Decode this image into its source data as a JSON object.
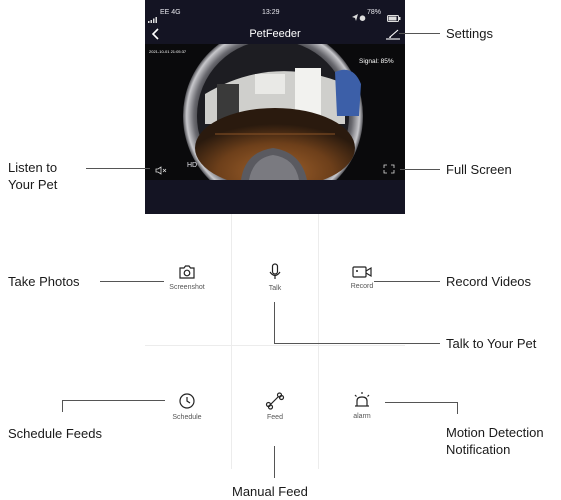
{
  "status_bar": {
    "carrier": "EE  4G",
    "time": "13:29",
    "battery": "78%"
  },
  "header": {
    "title": "PetFeeder"
  },
  "feed": {
    "timestamp": "2021-10-01 21:05:37",
    "signal": "Signal: 85%",
    "quality": "HD"
  },
  "controls": {
    "screenshot": "Screenshot",
    "talk": "Talk",
    "record": "Record",
    "schedule": "Schedule",
    "feed": "Feed",
    "alarm": "alarm"
  },
  "callouts": {
    "settings": "Settings",
    "listen_line1": "Listen to",
    "listen_line2": "Your Pet",
    "full_screen": "Full Screen",
    "take_photos": "Take Photos",
    "record_videos": "Record Videos",
    "talk_to_pet": "Talk to Your Pet",
    "schedule_feeds": "Schedule Feeds",
    "motion_line1": "Motion Detection",
    "motion_line2": "Notification",
    "manual_feed": "Manual Feed"
  }
}
